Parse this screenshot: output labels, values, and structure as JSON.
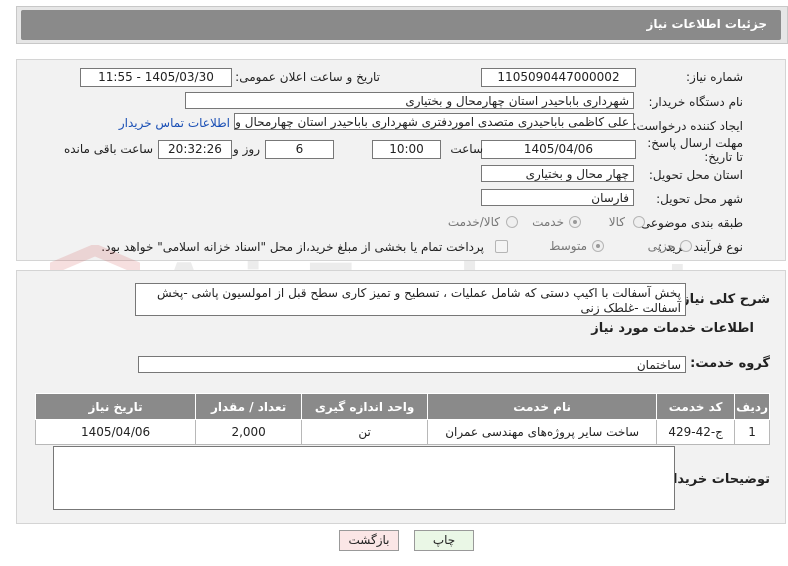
{
  "header": {
    "title": "جزئیات اطلاعات نیاز"
  },
  "form": {
    "need_number_label": "شماره نیاز:",
    "need_number": "1105090447000002",
    "announce_datetime_label": "تاریخ و ساعت اعلان عمومی:",
    "announce_datetime": "1405/03/30 - 11:55",
    "buyer_org_label": "نام دستگاه خریدار:",
    "buyer_org": "شهرداری باباحیدر استان چهارمحال و بختیاری",
    "requester_label": "ایجاد کننده درخواست:",
    "requester": "علی کاظمی باباحیدری متصدی اموردفتری شهرداری باباحیدر استان چهارمحال و",
    "contact_link": "اطلاعات تماس خریدار",
    "deadline_label": "مهلت ارسال پاسخ: تا تاریخ:",
    "deadline_date": "1405/04/06",
    "time_label": "ساعت",
    "deadline_time": "10:00",
    "days_value": "6",
    "days_label": "روز و",
    "remaining_time": "20:32:26",
    "remaining_label": "ساعت باقی مانده",
    "province_label": "استان محل تحویل:",
    "province": "چهار محال و بختیاری",
    "city_label": "شهر محل تحویل:",
    "city": "فارسان",
    "category_label": "طبقه بندی موضوعی:",
    "category_options": [
      "کالا",
      "خدمت",
      "کالا/خدمت"
    ],
    "category_selected": "خدمت",
    "process_label": "نوع فرآیند خرید :",
    "process_options": [
      "جزیی",
      "متوسط"
    ],
    "process_selected": "متوسط",
    "payment_note": "پرداخت تمام یا بخشی از مبلغ خرید،از محل \"اسناد خزانه اسلامی\" خواهد بود."
  },
  "details": {
    "description_label": "شرح کلی نیاز:",
    "description": "پخش آسفالت با اکیپ دستی که شامل عملیات ، تسطیح و تمیز کاری سطح قبل از امولسیون پاشی -پخش آسفالت -غلطک زنی",
    "services_heading": "اطلاعات خدمات مورد نیاز",
    "service_group_label": "گروه خدمت:",
    "service_group": "ساختمان",
    "table": {
      "headers": [
        "ردیف",
        "کد خدمت",
        "نام خدمت",
        "واحد اندازه گیری",
        "تعداد / مقدار",
        "تاریخ نیاز"
      ],
      "rows": [
        [
          "1",
          "ج-42-429",
          "ساخت سایر پروژه‌های مهندسی عمران",
          "تن",
          "2,000",
          "1405/04/06"
        ]
      ]
    },
    "buyer_notes_label": "توضیحات خریدار:",
    "buyer_notes": ""
  },
  "buttons": {
    "print": "چاپ",
    "back": "بازگشت"
  },
  "watermark": "AriaTender.net"
}
